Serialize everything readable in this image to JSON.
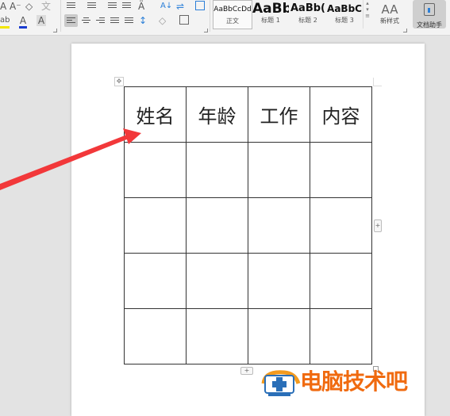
{
  "ribbon": {
    "font_group": {
      "grow_font_icon": "A⁺",
      "shrink_font_icon": "A⁻",
      "clear_format_icon": "eraser",
      "phonetic_icon": "文",
      "highlight_icon": "ab",
      "font_color_icon": "A",
      "char_shading_icon": "A",
      "highlight_color": "#f2e600",
      "font_color": "#1a3ccf"
    },
    "paragraph_group": {
      "buttons": [
        "bullets",
        "numbering",
        "decrease-indent",
        "increase-indent",
        "text-direction",
        "sort",
        "line-spacing-options",
        "borders-panel",
        "align-left",
        "align-center",
        "align-right",
        "justify",
        "distributed",
        "line-spacing",
        "shading",
        "borders"
      ],
      "active": "align-left"
    },
    "styles": [
      {
        "sample": "AaBbCcDd",
        "name": "正文",
        "selected": true
      },
      {
        "sample": "AaBb",
        "name": "标题 1",
        "selected": false
      },
      {
        "sample": "AaBb(",
        "name": "标题 2",
        "selected": false
      },
      {
        "sample": "AaBbC",
        "name": "标题 3",
        "selected": false
      }
    ],
    "new_style": {
      "icon": "AA",
      "label": "新样式"
    },
    "doc_helper": {
      "label": "文档助手"
    }
  },
  "document": {
    "table": {
      "headers": [
        "姓名",
        "年龄",
        "工作",
        "内容"
      ],
      "rows": [
        [
          "",
          "",
          "",
          ""
        ],
        [
          "",
          "",
          "",
          ""
        ],
        [
          "",
          "",
          "",
          ""
        ],
        [
          "",
          "",
          "",
          ""
        ]
      ]
    },
    "add_column_label": "+",
    "add_row_label": "+",
    "move_handle_label": "✥"
  },
  "annotation": {
    "arrow_color": "#f2383a"
  },
  "watermark": {
    "text": "电脑技术吧",
    "color": "#f06a0f"
  }
}
